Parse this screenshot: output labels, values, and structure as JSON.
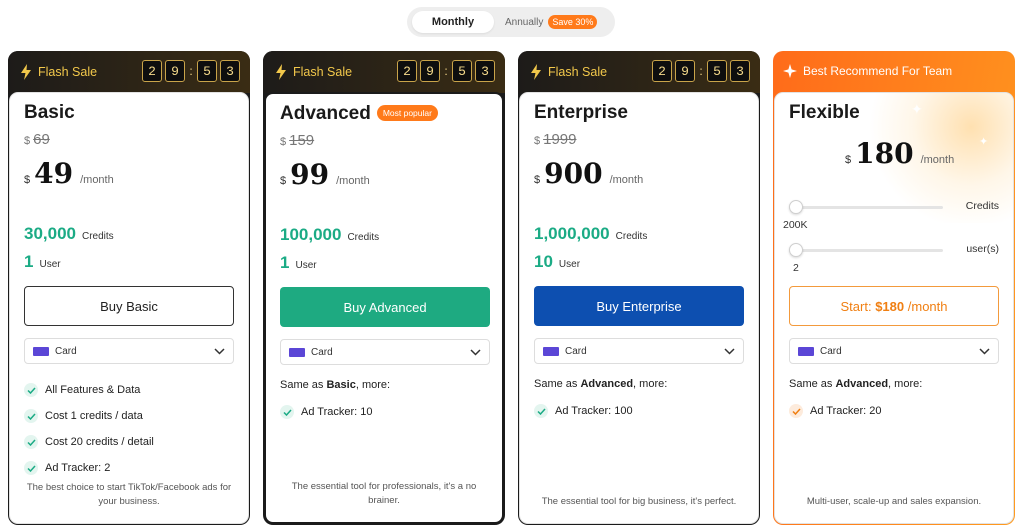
{
  "billing": {
    "monthly_label": "Monthly",
    "annual_label": "Annually",
    "save_badge": "Save 30%"
  },
  "flash_sale": {
    "label": "Flash Sale",
    "countdown": [
      "2",
      "9",
      "5",
      "3"
    ]
  },
  "plans": {
    "basic": {
      "name": "Basic",
      "currency": "$",
      "old_price": "69",
      "price": "49",
      "period": "/month",
      "credits": "30,000",
      "credits_label": "Credits",
      "users": "1",
      "users_label": "User",
      "button": "Buy Basic",
      "payment": "Card",
      "features": [
        "All Features & Data",
        "Cost 1 credits / data",
        "Cost 20 credits / detail",
        "Ad Tracker: 2"
      ],
      "tagline": "The best choice to start TikTok/Facebook ads for your business."
    },
    "advanced": {
      "name": "Advanced",
      "badge": "Most popular",
      "currency": "$",
      "old_price": "159",
      "price": "99",
      "period": "/month",
      "credits": "100,000",
      "credits_label": "Credits",
      "users": "1",
      "users_label": "User",
      "button": "Buy Advanced",
      "payment": "Card",
      "same_as_prefix": "Same as ",
      "same_as_plan": "Basic",
      "same_as_suffix": ", more:",
      "features": [
        "Ad Tracker: 10"
      ],
      "tagline": "The essential tool for professionals, it's a no brainer."
    },
    "enterprise": {
      "name": "Enterprise",
      "currency": "$",
      "old_price": "1999",
      "price": "900",
      "period": "/month",
      "credits": "1,000,000",
      "credits_label": "Credits",
      "users": "10",
      "users_label": "User",
      "button": "Buy Enterprise",
      "payment": "Card",
      "same_as_prefix": "Same as ",
      "same_as_plan": "Advanced",
      "same_as_suffix": ", more:",
      "features": [
        "Ad Tracker: 100"
      ],
      "tagline": "The essential tool for big business, it's perfect."
    },
    "flexible": {
      "header": "Best Recommend For Team",
      "name": "Flexible",
      "currency": "$",
      "price": "180",
      "period": "/month",
      "credits_slider_label": "Credits",
      "credits_value": "200K",
      "users_slider_label": "user(s)",
      "users_value": "2",
      "button_prefix": "Start: ",
      "button_price": "$180",
      "button_suffix": " /month",
      "payment": "Card",
      "same_as_prefix": "Same as ",
      "same_as_plan": "Advanced",
      "same_as_suffix": ", more:",
      "features": [
        "Ad Tracker: 20"
      ],
      "tagline": "Multi-user, scale-up and sales expansion."
    }
  },
  "colors": {
    "accent_green": "#1bab85",
    "button_green": "#1eaa81",
    "button_blue": "#0d4fb0",
    "brand_orange": "#ff7a1a",
    "flash_gold": "#f2c84b"
  },
  "icons": {
    "flash": "lightning-bolt-icon",
    "recommend": "sparkle-star-icon",
    "payment": "credit-card-icon",
    "dropdown": "chevron-down-icon",
    "feature": "check-icon"
  }
}
